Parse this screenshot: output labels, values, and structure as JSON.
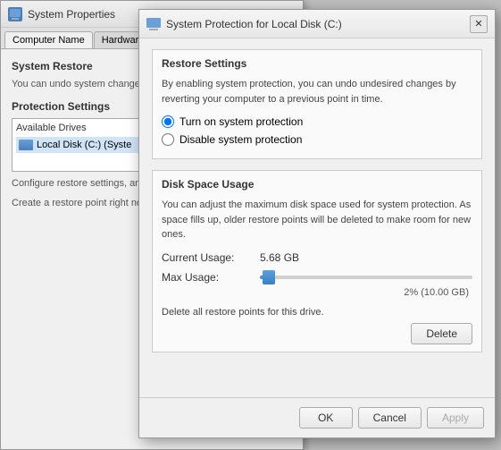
{
  "bg_window": {
    "title": "System Properties",
    "tabs": [
      "Computer Name",
      "Hardware"
    ],
    "sections": {
      "system_restore": {
        "title": "System Restore",
        "text": "You can undo system changes to your computer to a previous"
      },
      "protection_settings": {
        "title": "Protection Settings",
        "available_drives_label": "Available Drives",
        "drive_item": "Local Disk (C:) (Syste",
        "configure_text": "Configure restore settings, and delete restore points.",
        "create_text": "Create a restore point right now have system protection tur"
      }
    }
  },
  "dialog": {
    "title": "System Protection for Local Disk (C:)",
    "title_icon": "🖥",
    "close_btn": "✕",
    "restore_settings": {
      "group_title": "Restore Settings",
      "description": "By enabling system protection, you can undo undesired changes by reverting your computer to a previous point in time.",
      "radio_on": "Turn on system protection",
      "radio_off": "Disable system protection",
      "radio_on_selected": true
    },
    "disk_space": {
      "group_title": "Disk Space Usage",
      "description": "You can adjust the maximum disk space used for system protection. As space fills up, older restore points will be deleted to make room for new ones.",
      "current_usage_label": "Current Usage:",
      "current_usage_value": "5.68 GB",
      "max_usage_label": "Max Usage:",
      "slider_percent": "2% (10.00 GB)",
      "delete_text": "Delete all restore points for this drive.",
      "delete_btn": "Delete"
    },
    "footer": {
      "ok_btn": "OK",
      "cancel_btn": "Cancel",
      "apply_btn": "Apply"
    }
  }
}
